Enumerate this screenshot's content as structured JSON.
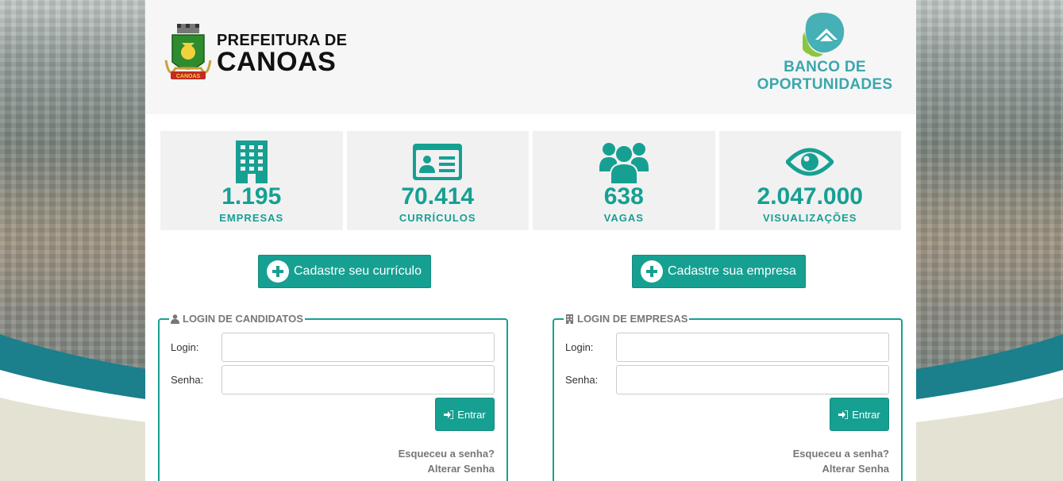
{
  "header": {
    "prefeitura_line1": "PREFEITURA DE",
    "prefeitura_line2": "CANOAS",
    "crest_banner": "CANOAS",
    "banco_line1": "BANCO DE",
    "banco_line2": "OPORTUNIDADES"
  },
  "stats": [
    {
      "icon": "building-icon",
      "value": "1.195",
      "label": "EMPRESAS"
    },
    {
      "icon": "id-card-icon",
      "value": "70.414",
      "label": "CURRÍCULOS"
    },
    {
      "icon": "users-icon",
      "value": "638",
      "label": "VAGAS"
    },
    {
      "icon": "eye-icon",
      "value": "2.047.000",
      "label": "VISUALIZAÇÕES"
    }
  ],
  "actions": {
    "register_cv": "Cadastre seu currículo",
    "register_company": "Cadastre sua empresa"
  },
  "login_candidates": {
    "title": "LOGIN DE CANDIDATOS",
    "login_label": "Login:",
    "password_label": "Senha:",
    "login_value": "",
    "password_value": "",
    "enter": "Entrar",
    "forgot": "Esqueceu a senha?",
    "change": "Alterar Senha"
  },
  "login_companies": {
    "title": "LOGIN DE EMPRESAS",
    "login_label": "Login:",
    "password_label": "Senha:",
    "login_value": "",
    "password_value": "",
    "enter": "Entrar",
    "forgot": "Esqueceu a senha?",
    "change": "Alterar Senha"
  },
  "colors": {
    "accent": "#16a092",
    "banco_text": "#3aa7ad",
    "muted_text": "#777777",
    "stat_bg": "#f1f1f2"
  }
}
